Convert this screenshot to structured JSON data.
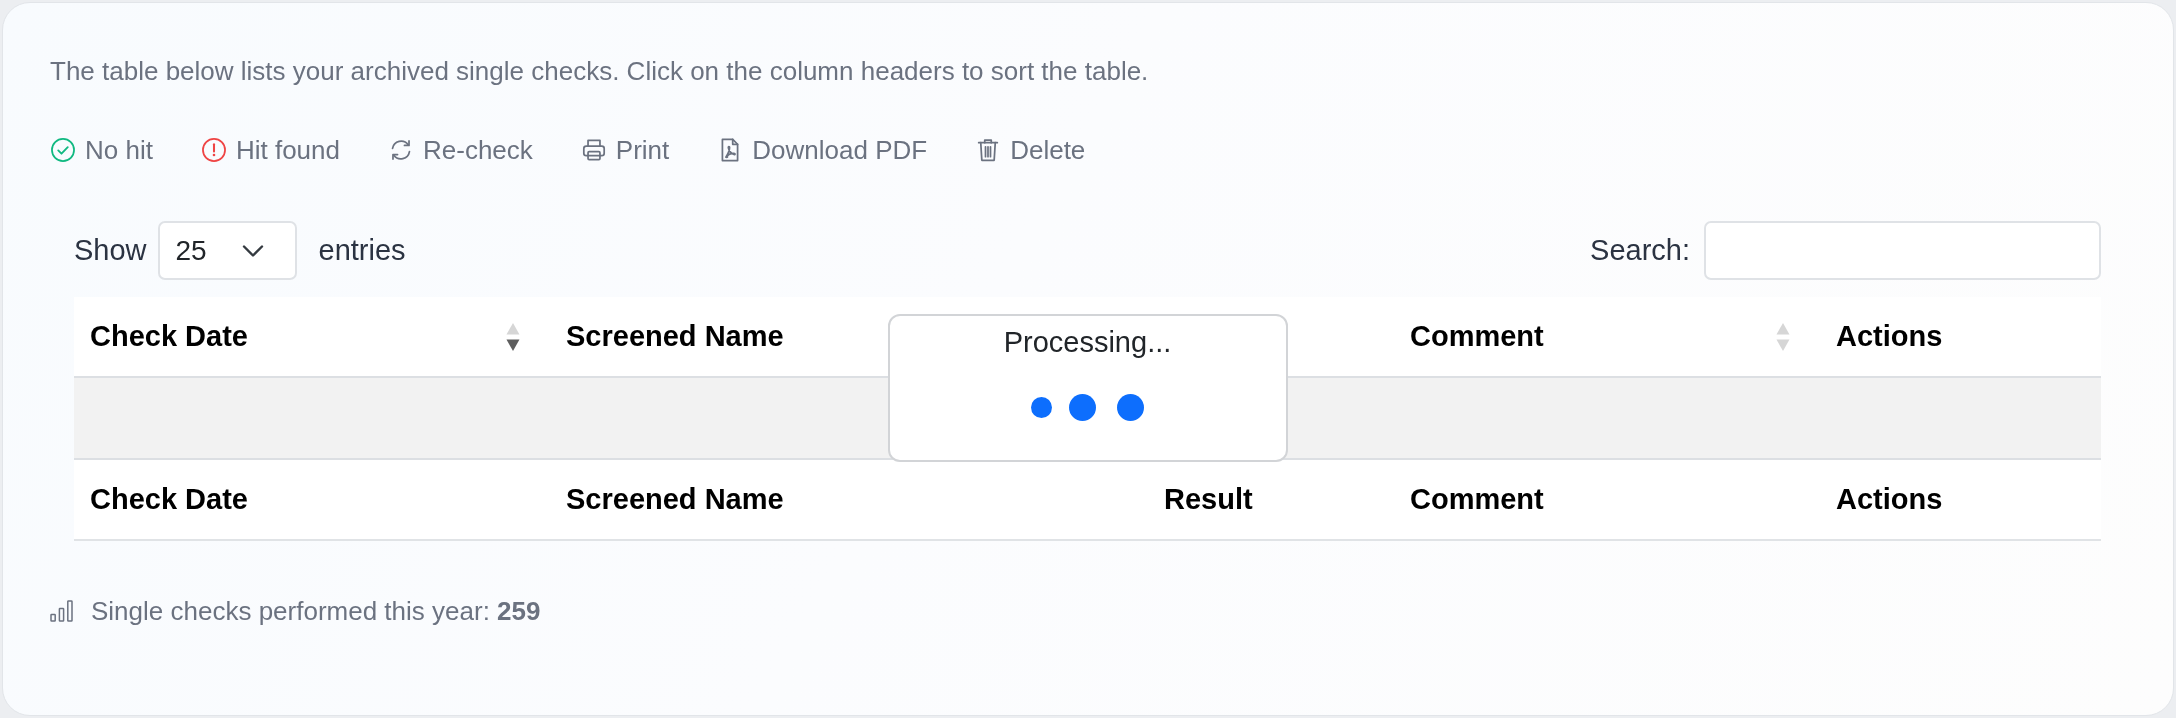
{
  "intro": "The table below lists your archived single checks. Click on the column headers to sort the table.",
  "toolbar": [
    {
      "label": "No hit"
    },
    {
      "label": "Hit found"
    },
    {
      "label": "Re-check"
    },
    {
      "label": "Print"
    },
    {
      "label": "Download PDF"
    },
    {
      "label": "Delete"
    }
  ],
  "length_menu": {
    "prefix": "Show",
    "value": "25",
    "suffix": "entries"
  },
  "search": {
    "label": "Search:"
  },
  "table": {
    "columns": [
      {
        "label": "Check Date",
        "sort_icon": {
          "descending": true
        }
      },
      {
        "label": "Screened Name"
      },
      {},
      {
        "label": "Comment",
        "sort_icon": {
          "descending": false
        }
      },
      {
        "label": "Actions"
      }
    ],
    "footer": [
      "Check Date",
      "Screened Name",
      "Result",
      "Comment",
      "Actions"
    ]
  },
  "processing": {
    "label": "Processing..."
  },
  "stats": "Single checks performed this year: **259**"
}
